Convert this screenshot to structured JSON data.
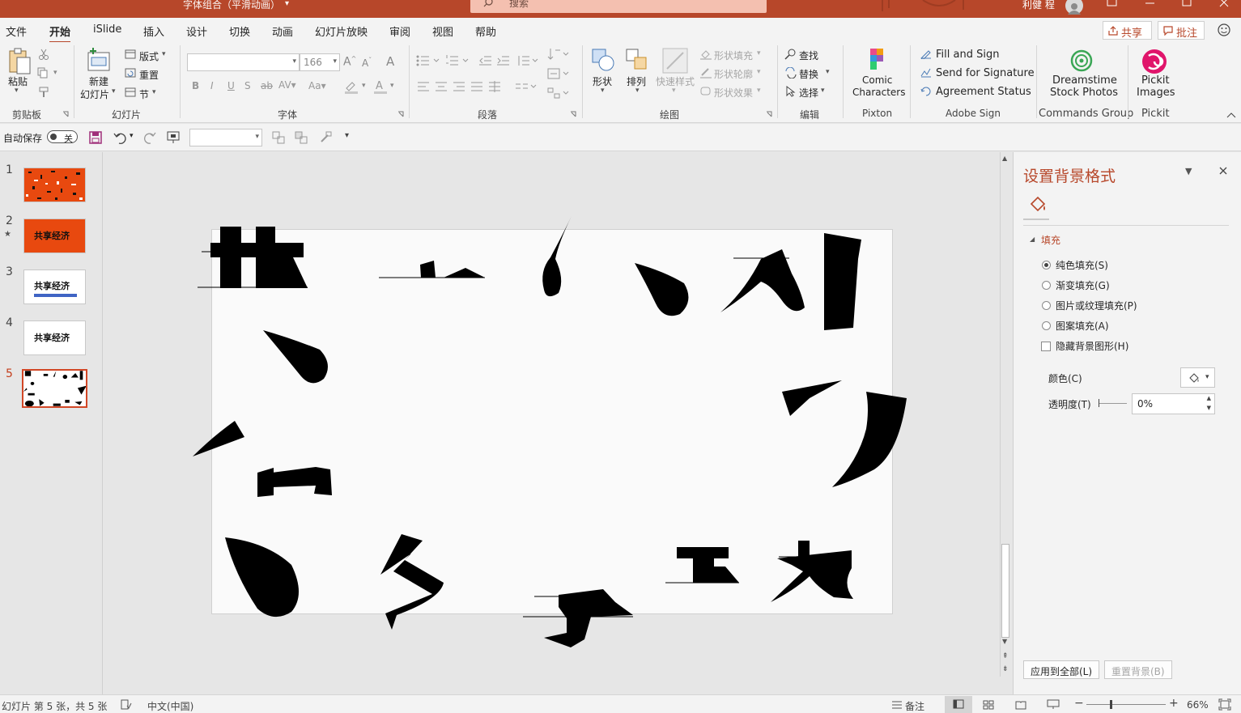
{
  "window": {
    "title": "字体组合（平滑动画）",
    "search_placeholder": "搜索",
    "user_name": "利健 程"
  },
  "tabs": [
    "文件",
    "开始",
    "iSlide",
    "插入",
    "设计",
    "切换",
    "动画",
    "幻灯片放映",
    "审阅",
    "视图",
    "帮助"
  ],
  "active_tab": "开始",
  "header_buttons": {
    "share": "共享",
    "comment": "批注"
  },
  "ribbon": {
    "clipboard": {
      "paste": "粘贴",
      "label": "剪贴板"
    },
    "slides": {
      "new_slide_line1": "新建",
      "new_slide_line2": "幻灯片",
      "layout": "版式",
      "reset": "重置",
      "section": "节",
      "label": "幻灯片"
    },
    "font": {
      "size": "166",
      "label": "字体"
    },
    "paragraph": {
      "label": "段落"
    },
    "drawing": {
      "shapes": "形状",
      "arrange": "排列",
      "quick_styles": "快速样式",
      "fill": "形状填充",
      "outline": "形状轮廓",
      "effects": "形状效果",
      "label": "绘图"
    },
    "editing": {
      "find": "查找",
      "replace": "替换",
      "select": "选择",
      "label": "编辑"
    },
    "pixton": {
      "line1": "Comic",
      "line2": "Characters",
      "label": "Pixton"
    },
    "adobe": {
      "fill_sign": "Fill and Sign",
      "send_sig": "Send for Signature",
      "agreement": "Agreement Status",
      "label": "Adobe Sign"
    },
    "dreamstime": {
      "line1": "Dreamstime",
      "line2": "Stock Photos",
      "label": "Commands Group"
    },
    "pickit": {
      "line1": "Pickit",
      "line2": "Images",
      "label": "Pickit"
    }
  },
  "qat": {
    "autosave_label": "自动保存",
    "autosave_state": "关"
  },
  "slides": [
    {
      "number": "1",
      "text": "",
      "style": "orange-scatter"
    },
    {
      "number": "2",
      "text": "共享经济",
      "style": "orange-title",
      "star": "★"
    },
    {
      "number": "3",
      "text": "共享经济",
      "style": "white-underline"
    },
    {
      "number": "4",
      "text": "共享经济",
      "style": "white-title"
    },
    {
      "number": "5",
      "text": "",
      "style": "white-scatter",
      "selected": true
    }
  ],
  "pane": {
    "title": "设置背景格式",
    "section": "填充",
    "options": [
      "纯色填充(S)",
      "渐变填充(G)",
      "图片或纹理填充(P)",
      "图案填充(A)"
    ],
    "selected_option": "纯色填充(S)",
    "hide_bg": "隐藏背景图形(H)",
    "color_label": "颜色(C)",
    "transparency_label": "透明度(T)",
    "transparency_value": "0%",
    "apply_all": "应用到全部(L)",
    "reset_bg": "重置背景(B)"
  },
  "status": {
    "slide_info": "幻灯片 第 5 张，共 5 张",
    "language": "中文(中国)",
    "notes": "备注",
    "zoom": "66%"
  },
  "colors": {
    "accent": "#b7472a",
    "selection": "#d24726",
    "slide_orange": "#e8490f"
  }
}
